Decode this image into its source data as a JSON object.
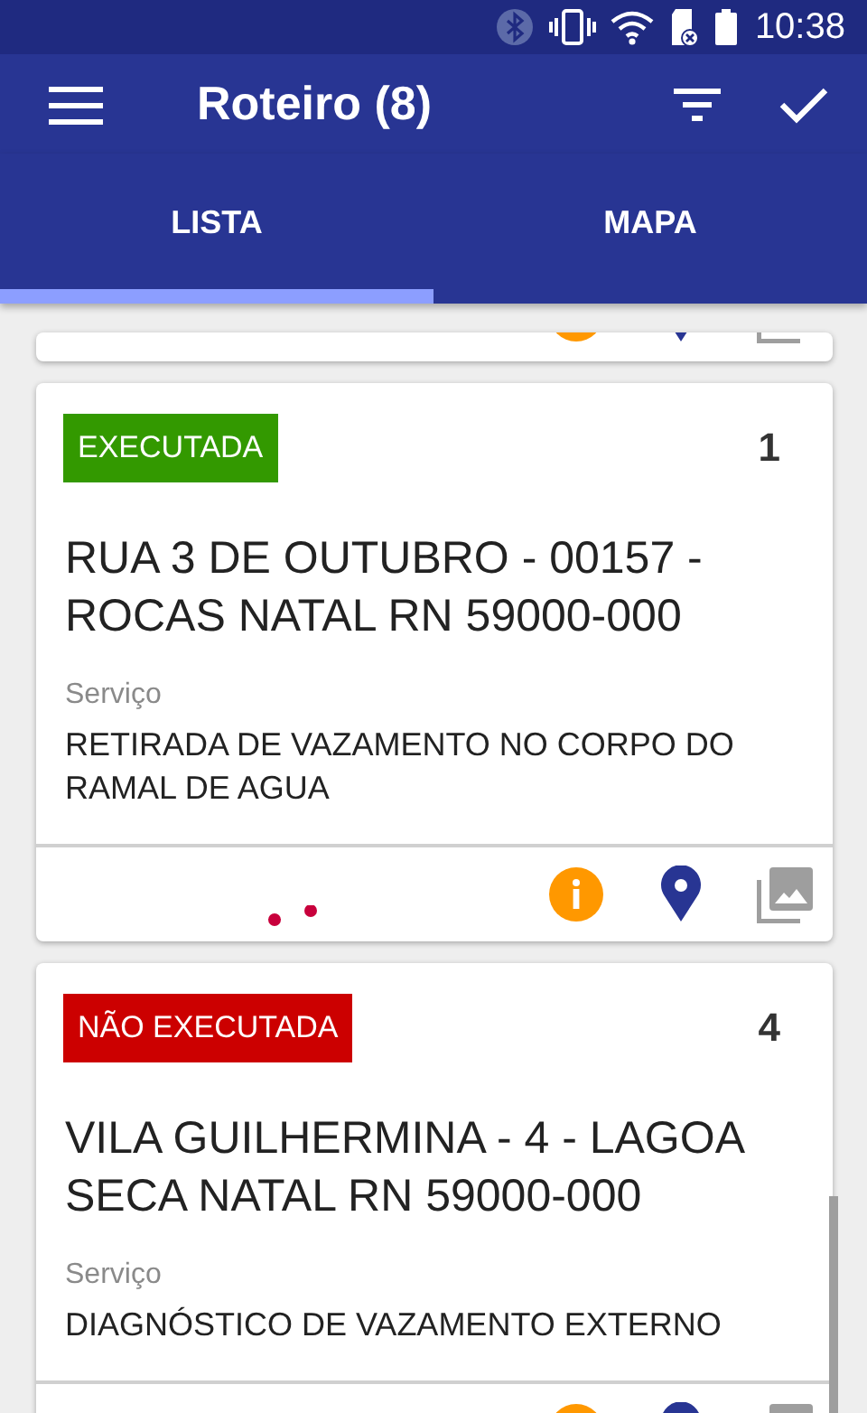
{
  "status_bar": {
    "time": "10:38"
  },
  "app_bar": {
    "title": "Roteiro (8)"
  },
  "tabs": [
    {
      "label": "LISTA",
      "selected": true
    },
    {
      "label": "MAPA",
      "selected": false
    }
  ],
  "cards": [
    {
      "kind": "footer_only"
    },
    {
      "kind": "full",
      "status": "EXECUTADA",
      "color": "#339900",
      "number": "1",
      "address": "RUA 3 DE OUTUBRO - 00157 - ROCAS NATAL RN 59000-000",
      "service_label": "Serviço",
      "service": "RETIRADA DE VAZAMENTO NO CORPO DO RAMAL DE AGUA"
    },
    {
      "kind": "full",
      "status": "NÃO EXECUTADA",
      "color": "#cc0000",
      "number": "4",
      "address": "VILA GUILHERMINA - 4 - LAGOA SECA NATAL RN 59000-000",
      "service_label": "Serviço",
      "service": "DIAGNÓSTICO DE VAZAMENTO EXTERNO"
    }
  ]
}
